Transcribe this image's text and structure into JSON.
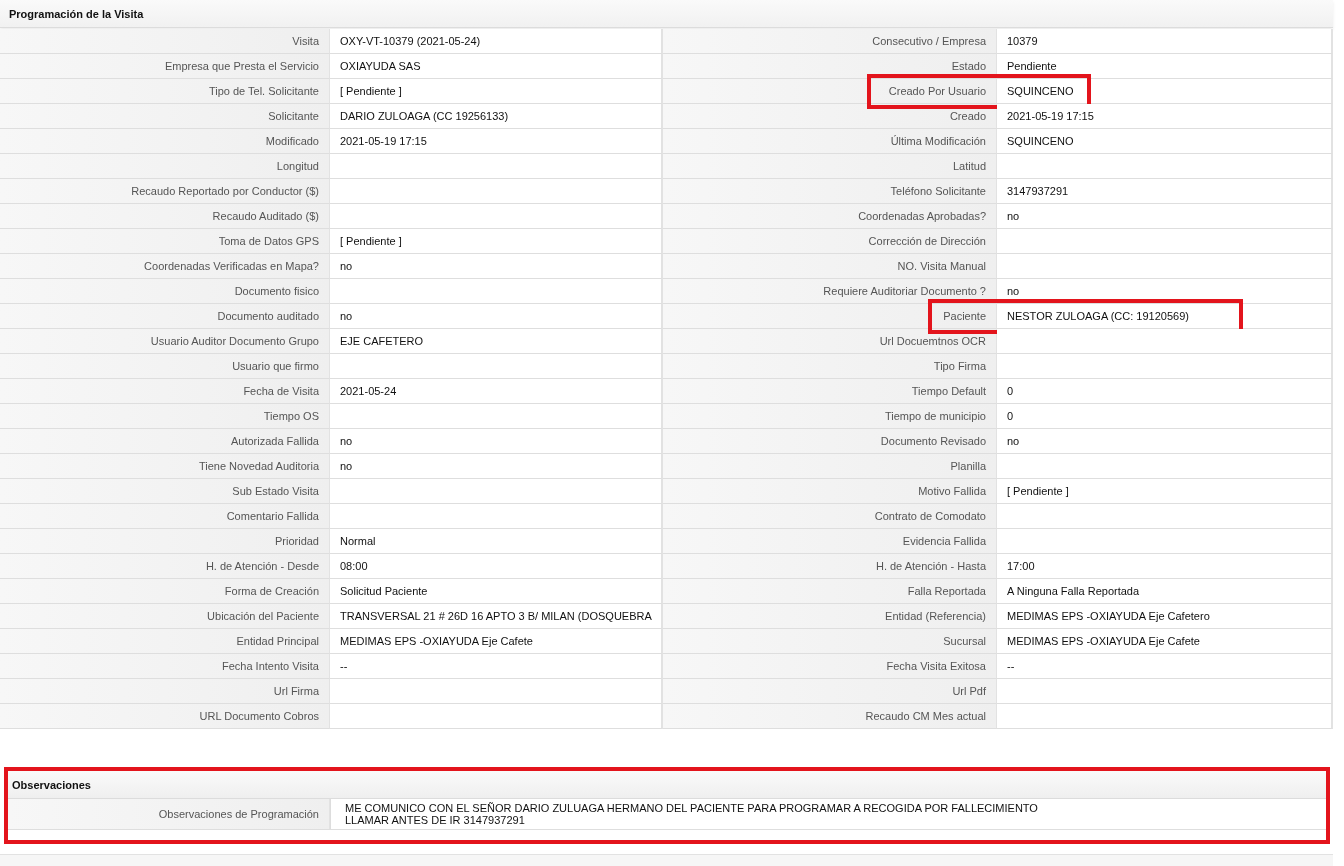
{
  "panel": {
    "title": "Programación de la Visita"
  },
  "rows": [
    [
      {
        "label": "Visita",
        "value": "OXY-VT-10379 (2021-05-24)",
        "highlighted": false
      },
      {
        "label": "Consecutivo / Empresa",
        "value": "10379",
        "highlighted": false
      }
    ],
    [
      {
        "label": "Empresa que Presta el Servicio",
        "value": "OXIAYUDA SAS",
        "highlighted": false
      },
      {
        "label": "Estado",
        "value": "Pendiente",
        "highlighted": false
      }
    ],
    [
      {
        "label": "Tipo de Tel. Solicitante",
        "value": "[ Pendiente ]",
        "highlighted": false
      },
      {
        "label": "Creado Por Usuario",
        "value": "SQUINCENO",
        "highlighted": true
      }
    ],
    [
      {
        "label": "Solicitante",
        "value": "DARIO ZULOAGA (CC 19256133)",
        "highlighted": false
      },
      {
        "label": "Creado",
        "value": "2021-05-19 17:15",
        "highlighted": false
      }
    ],
    [
      {
        "label": "Modificado",
        "value": "2021-05-19 17:15",
        "highlighted": false
      },
      {
        "label": "Última Modificación",
        "value": "SQUINCENO",
        "highlighted": false
      }
    ],
    [
      {
        "label": "Longitud",
        "highlighted": false
      },
      {
        "label": "Latitud",
        "highlighted": false
      }
    ],
    [
      {
        "label": "Recaudo Reportado por Conductor ($)",
        "highlighted": false
      },
      {
        "label": "Teléfono Solicitante",
        "value": "3147937291",
        "highlighted": false
      }
    ],
    [
      {
        "label": "Recaudo Auditado ($)",
        "highlighted": false
      },
      {
        "label": "Coordenadas Aprobadas?",
        "value": "no",
        "highlighted": false
      }
    ],
    [
      {
        "label": "Toma de Datos GPS",
        "value": "[ Pendiente ]",
        "highlighted": false
      },
      {
        "label": "Corrección de Dirección",
        "highlighted": false
      }
    ],
    [
      {
        "label": "Coordenadas Verificadas en Mapa?",
        "value": "no",
        "highlighted": false
      },
      {
        "label": "NO. Visita Manual",
        "highlighted": false
      }
    ],
    [
      {
        "label": "Documento fisico",
        "highlighted": false
      },
      {
        "label": "Requiere Auditoriar Documento ?",
        "value": "no",
        "highlighted": false
      }
    ],
    [
      {
        "label": "Documento auditado",
        "value": "no",
        "highlighted": false
      },
      {
        "label": "Paciente",
        "value": "NESTOR ZULOAGA (CC: 19120569)",
        "highlighted": true
      }
    ],
    [
      {
        "label": "Usuario Auditor Documento Grupo",
        "value": "EJE CAFETERO",
        "highlighted": false
      },
      {
        "label": "Url Docuemtnos OCR",
        "highlighted": false
      }
    ],
    [
      {
        "label": "Usuario que firmo",
        "highlighted": false
      },
      {
        "label": "Tipo Firma",
        "highlighted": false
      }
    ],
    [
      {
        "label": "Fecha de Visita",
        "value": "2021-05-24",
        "highlighted": false
      },
      {
        "label": "Tiempo Default",
        "value": "0",
        "highlighted": false
      }
    ],
    [
      {
        "label": "Tiempo OS",
        "highlighted": false
      },
      {
        "label": "Tiempo de municipio",
        "value": "0",
        "highlighted": false
      }
    ],
    [
      {
        "label": "Autorizada Fallida",
        "value": "no",
        "highlighted": false
      },
      {
        "label": "Documento Revisado",
        "value": "no",
        "highlighted": false
      }
    ],
    [
      {
        "label": "Tiene Novedad Auditoria",
        "value": "no",
        "highlighted": false
      },
      {
        "label": "Planilla",
        "highlighted": false
      }
    ],
    [
      {
        "label": "Sub Estado Visita",
        "highlighted": false
      },
      {
        "label": "Motivo Fallida",
        "value": "[ Pendiente ]",
        "highlighted": false
      }
    ],
    [
      {
        "label": "Comentario Fallida",
        "highlighted": false
      },
      {
        "label": "Contrato de Comodato",
        "highlighted": false
      }
    ],
    [
      {
        "label": "Prioridad",
        "value": "Normal",
        "highlighted": false
      },
      {
        "label": "Evidencia Fallida",
        "highlighted": false
      }
    ],
    [
      {
        "label": "H. de Atención - Desde",
        "value": "08:00",
        "highlighted": false
      },
      {
        "label": "H. de Atención - Hasta",
        "value": "17:00",
        "highlighted": false
      }
    ],
    [
      {
        "label": "Forma de Creación",
        "value": "Solicitud Paciente",
        "highlighted": false
      },
      {
        "label": "Falla Reportada",
        "value": "A Ninguna Falla Reportada",
        "highlighted": false
      }
    ],
    [
      {
        "label": "Ubicación del Paciente",
        "value": "TRANSVERSAL 21 # 26D 16 APTO 3 B/ MILAN (DOSQUEBRA",
        "highlighted": false
      },
      {
        "label": "Entidad (Referencia)",
        "value": "MEDIMAS EPS -OXIAYUDA Eje Cafetero",
        "highlighted": false
      }
    ],
    [
      {
        "label": "Entidad Principal",
        "value": "MEDIMAS EPS -OXIAYUDA Eje Cafete",
        "highlighted": false
      },
      {
        "label": "Sucursal",
        "value": "MEDIMAS EPS -OXIAYUDA Eje Cafete",
        "highlighted": false
      }
    ],
    [
      {
        "label": "Fecha Intento Visita",
        "value": "--",
        "highlighted": false
      },
      {
        "label": "Fecha Visita Exitosa",
        "value": "--",
        "highlighted": false
      }
    ],
    [
      {
        "label": "Url Firma",
        "highlighted": false
      },
      {
        "label": "Url Pdf",
        "highlighted": false
      }
    ],
    [
      {
        "label": "URL Documento Cobros",
        "highlighted": false
      },
      {
        "label": "Recaudo CM Mes actual",
        "highlighted": false
      }
    ]
  ],
  "observations": {
    "title": "Observaciones",
    "highlighted": true,
    "label": "Observaciones de Programación",
    "lines": [
      "ME COMUNICO CON EL SEÑOR DARIO ZULUAGA HERMANO DEL PACIENTE PARA PROGRAMAR A RECOGIDA POR FALLECIMIENTO",
      "LLAMAR ANTES DE IR 3147937291"
    ]
  }
}
